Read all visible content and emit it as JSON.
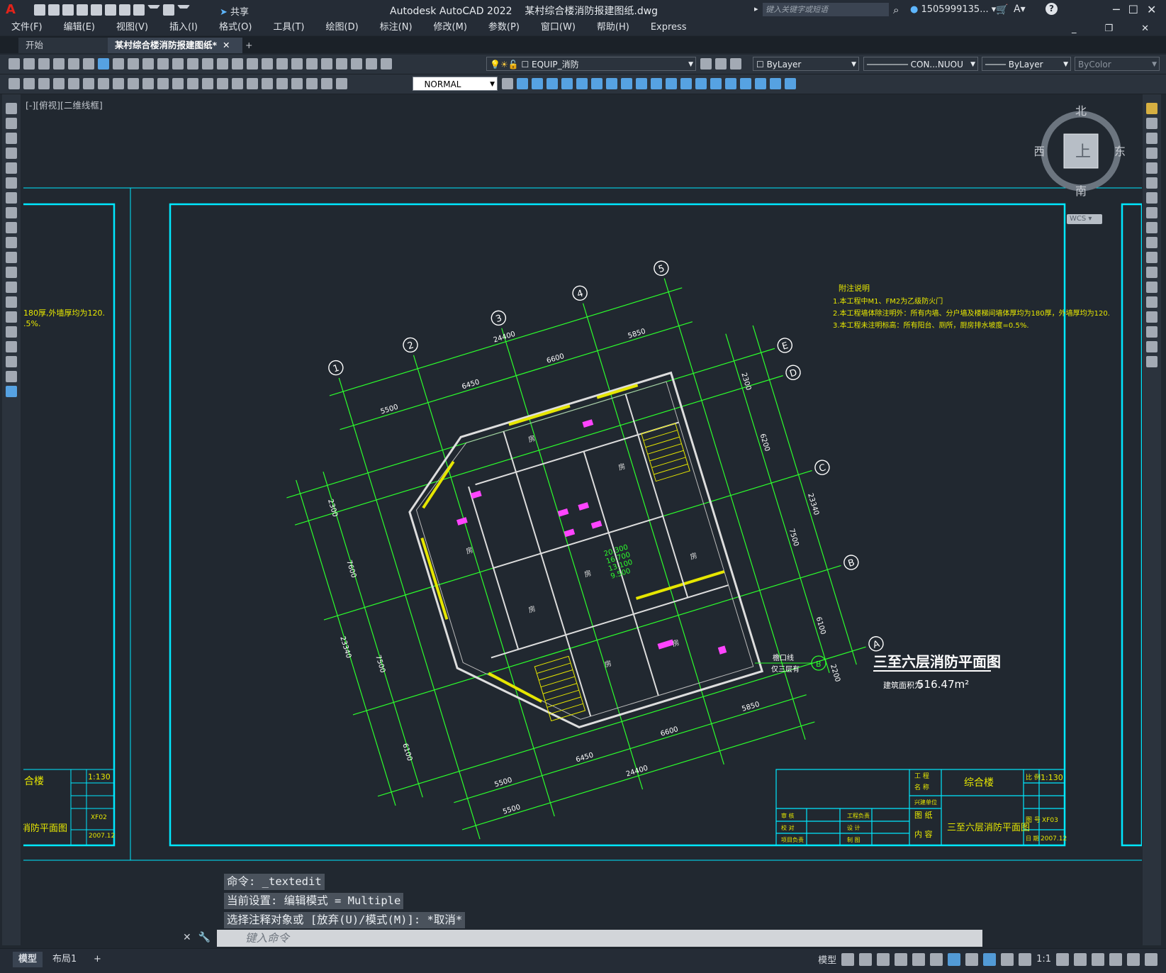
{
  "app": {
    "title": "Autodesk AutoCAD 2022    某村综合楼消防报建图纸.dwg",
    "share_label": "共享",
    "search_placeholder": "键入关键字或短语",
    "user_name": "1505999135...",
    "menu": [
      "文件(F)",
      "编辑(E)",
      "视图(V)",
      "插入(I)",
      "格式(O)",
      "工具(T)",
      "绘图(D)",
      "标注(N)",
      "修改(M)",
      "参数(P)",
      "窗口(W)",
      "帮助(H)",
      "Express"
    ]
  },
  "tabs": {
    "start": "开始",
    "doc": "某村综合楼消防报建图纸*",
    "plus": "+"
  },
  "toolbar": {
    "layer_name": "EQUIP_消防",
    "color": "ByLayer",
    "linetype": "CON...NUOU",
    "lineweight": "ByLayer",
    "plotstyle": "ByColor",
    "textstyle": "NORMAL"
  },
  "viewport": {
    "label": "[-][俯视][二维线框]",
    "compass_n": "北",
    "compass_s": "南",
    "compass_e": "东",
    "compass_w": "西",
    "cube_face": "上",
    "wcs": "WCS"
  },
  "drawing": {
    "plan_title": "三至六层消防平面图",
    "area_prefix": "建筑面积为",
    "area_value": "516.47m²",
    "notes_title": "附注说明",
    "notes": [
      "1.本工程中M1、FM2为乙级防火门",
      "2.本工程墙体除注明外：所有内墙、分户墙及楼梯间墙体厚均为180厚，外墙厚均为120.",
      "3.本工程未注明标高：所有阳台、厕所，厨房排水坡度=0.5%."
    ],
    "elev_labels": [
      "20.300",
      "16.700",
      "13.100",
      "9.500"
    ],
    "axes_top": [
      "1",
      "2",
      "3",
      "4",
      "5"
    ],
    "axes_right": [
      "E",
      "D",
      "C",
      "B",
      "A"
    ],
    "dims_top": [
      "5500",
      "6450",
      "24400",
      "6600",
      "5850"
    ],
    "dims_bottom": [
      "5500",
      "5500",
      "6450",
      "24400",
      "6600",
      "5850"
    ],
    "dims_left": [
      "2300",
      "7600",
      "23340",
      "7500",
      "6100"
    ],
    "dims_right": [
      "2300",
      "6200",
      "23340",
      "7500",
      "6100",
      "2200"
    ],
    "eave_note": [
      "檐口线",
      "仅三层有"
    ],
    "room_label": "房",
    "title_block": {
      "project_label": "工 程\n名 称",
      "project_name": "综合楼",
      "scale_label": "比 例",
      "scale": "1:130",
      "sheet_label": "图 纸\n内 容",
      "sheet_name": "三至六层消防平面图",
      "drawing_no_label": "图 号",
      "drawing_no": "XF03",
      "date_label": "日 期",
      "date": "2007.12",
      "rows": [
        "审 核",
        "校 对",
        "设 计",
        "制 图",
        "工程负责",
        "项目负责"
      ]
    },
    "left_block": {
      "project_name": "合楼",
      "sheet_name": "消防平面图",
      "scale": "1:130",
      "drawing_no": "XF02",
      "date": "2007.12",
      "note1": "180厚,外墙厚均为120.",
      "note2": ".5%."
    }
  },
  "command": {
    "history": [
      "命令: _textedit",
      "当前设置: 编辑模式 = Multiple",
      "选择注释对象或 [放弃(U)/模式(M)]: *取消*"
    ],
    "placeholder": "键入命令"
  },
  "status": {
    "model_tab": "模型",
    "layout_tab": "布局1",
    "plus": "+",
    "model_label": "模型",
    "scale": "1:1"
  },
  "colors": {
    "background": "#212830",
    "frame": "#00e8ff",
    "plan_lines": "#2cff2c",
    "walls": "#dddddd",
    "doors": "#ff44ff",
    "windows": "#e6e600"
  }
}
